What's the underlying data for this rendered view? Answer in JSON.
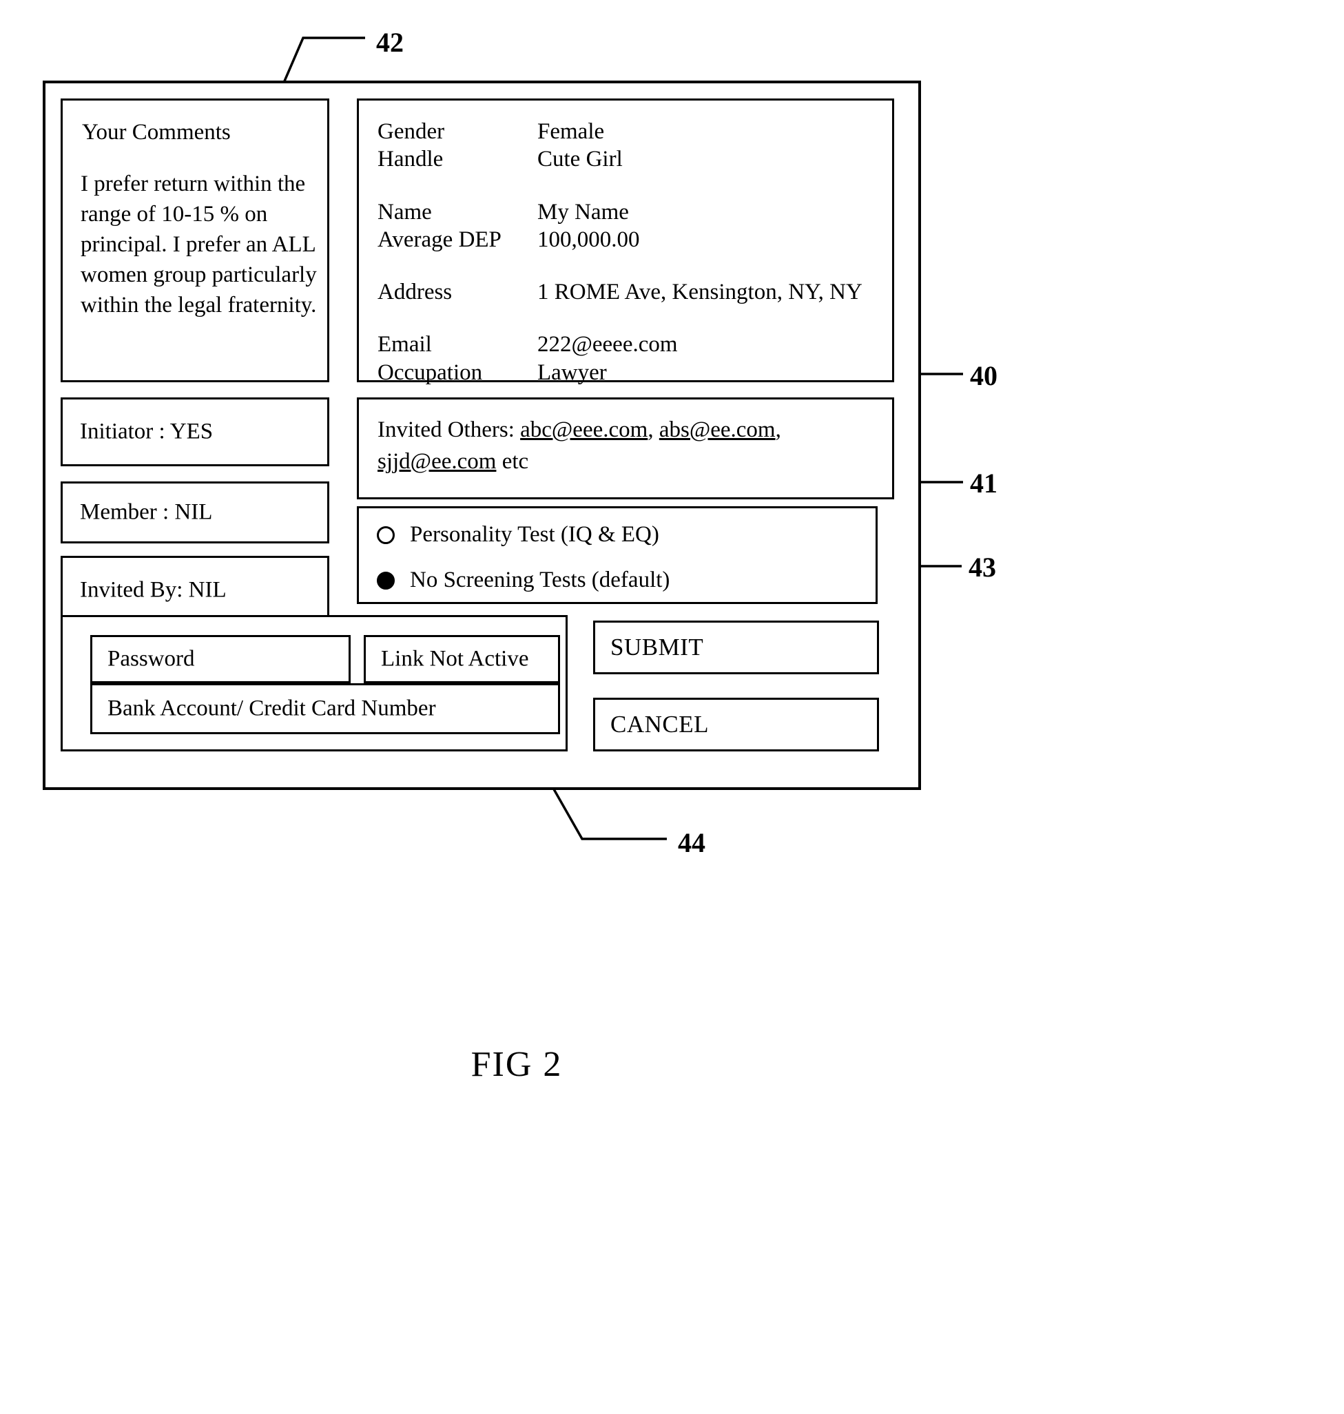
{
  "figure": {
    "caption": "FIG 2",
    "reference_numerals": [
      {
        "id": "42",
        "label": "42"
      },
      {
        "id": "40",
        "label": "40"
      },
      {
        "id": "41",
        "label": "41"
      },
      {
        "id": "43",
        "label": "43"
      },
      {
        "id": "44",
        "label": "44"
      }
    ]
  },
  "comments_panel": {
    "title": "Your Comments",
    "body": "I prefer return within the range of 10-15 % on principal. I prefer an ALL women group particularly within the legal fraternity."
  },
  "profile_panel": {
    "rows": [
      {
        "key": "Gender",
        "value": "Female"
      },
      {
        "key": "Handle",
        "value": "Cute Girl"
      },
      {
        "key": "Name",
        "value": "My Name"
      },
      {
        "key": "Average DEP",
        "value": "100,000.00"
      },
      {
        "key": "Address",
        "value": "1 ROME Ave, Kensington, NY, NY"
      },
      {
        "key": "Email",
        "value": "222@eeee.com"
      },
      {
        "key": "Occupation",
        "value": "Lawyer"
      }
    ]
  },
  "status_boxes": {
    "initiator": "Initiator : YES",
    "member": "Member : NIL",
    "invited_by": "Invited By: NIL"
  },
  "invited_others": {
    "label": "Invited Others:",
    "emails": [
      "abc@eee.com",
      "abs@ee.com",
      "sjjd@ee.com"
    ],
    "suffix": "etc"
  },
  "screening_tests": {
    "options": [
      {
        "label": "Personality Test (IQ & EQ)",
        "selected": false
      },
      {
        "label": "No Screening Tests (default)",
        "selected": true
      }
    ]
  },
  "credentials": {
    "password_placeholder": "Password",
    "link_status": "Link Not Active",
    "bank_placeholder": "Bank Account/ Credit Card Number"
  },
  "actions": {
    "submit_label": "SUBMIT",
    "cancel_label": "CANCEL"
  }
}
